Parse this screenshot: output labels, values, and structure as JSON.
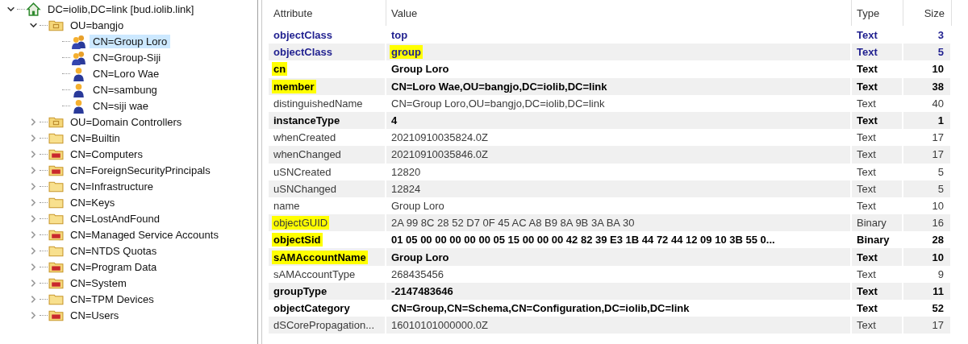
{
  "tree": {
    "label": "DC=iolib,DC=link [bud.iolib.link]",
    "kind": "domain",
    "expanded": true,
    "selected": false,
    "children": [
      {
        "label": "OU=bangjo",
        "kind": "ou",
        "expanded": true,
        "selected": false,
        "children": [
          {
            "label": "CN=Group Loro",
            "kind": "group",
            "selected": true
          },
          {
            "label": "CN=Group-Siji",
            "kind": "group",
            "selected": false
          },
          {
            "label": "CN=Loro Wae",
            "kind": "user",
            "selected": false
          },
          {
            "label": "CN=sambung",
            "kind": "user",
            "selected": false
          },
          {
            "label": "CN=siji wae",
            "kind": "user",
            "selected": false
          }
        ]
      },
      {
        "label": "OU=Domain Controllers",
        "kind": "ou",
        "expanded": false,
        "selected": false
      },
      {
        "label": "CN=Builtin",
        "kind": "folder",
        "expanded": false,
        "selected": false
      },
      {
        "label": "CN=Computers",
        "kind": "container",
        "expanded": false,
        "selected": false
      },
      {
        "label": "CN=ForeignSecurityPrincipals",
        "kind": "container",
        "expanded": false,
        "selected": false
      },
      {
        "label": "CN=Infrastructure",
        "kind": "folder",
        "expanded": false,
        "selected": false
      },
      {
        "label": "CN=Keys",
        "kind": "folder",
        "expanded": false,
        "selected": false
      },
      {
        "label": "CN=LostAndFound",
        "kind": "folder",
        "expanded": false,
        "selected": false
      },
      {
        "label": "CN=Managed Service Accounts",
        "kind": "container",
        "expanded": false,
        "selected": false
      },
      {
        "label": "CN=NTDS Quotas",
        "kind": "folder",
        "expanded": false,
        "selected": false
      },
      {
        "label": "CN=Program Data",
        "kind": "container",
        "expanded": false,
        "selected": false
      },
      {
        "label": "CN=System",
        "kind": "container",
        "expanded": false,
        "selected": false
      },
      {
        "label": "CN=TPM Devices",
        "kind": "folder",
        "expanded": false,
        "selected": false
      },
      {
        "label": "CN=Users",
        "kind": "container",
        "expanded": false,
        "selected": false
      }
    ]
  },
  "table": {
    "columns": [
      "Attribute",
      "Value",
      "Type",
      "Size"
    ],
    "rows": [
      {
        "kind": "class",
        "attribute": "objectClass",
        "value": "top",
        "type": "Text",
        "size": "3",
        "attribute_highlighted": false,
        "value_highlighted": false
      },
      {
        "kind": "class",
        "attribute": "objectClass",
        "value": "group",
        "type": "Text",
        "size": "5",
        "attribute_highlighted": false,
        "value_highlighted": true
      },
      {
        "kind": "bold",
        "attribute": "cn",
        "value": "Group Loro",
        "type": "Text",
        "size": "10",
        "attribute_highlighted": true,
        "value_highlighted": false
      },
      {
        "kind": "bold",
        "attribute": "member",
        "value": "CN=Loro Wae,OU=bangjo,DC=iolib,DC=link",
        "type": "Text",
        "size": "38",
        "attribute_highlighted": true,
        "value_highlighted": false
      },
      {
        "kind": "plain",
        "attribute": "distinguishedName",
        "value": "CN=Group Loro,OU=bangjo,DC=iolib,DC=link",
        "type": "Text",
        "size": "40",
        "attribute_highlighted": false,
        "value_highlighted": false
      },
      {
        "kind": "bold",
        "attribute": "instanceType",
        "value": "4",
        "type": "Text",
        "size": "1",
        "attribute_highlighted": false,
        "value_highlighted": false
      },
      {
        "kind": "plain",
        "attribute": "whenCreated",
        "value": "20210910035824.0Z",
        "type": "Text",
        "size": "17",
        "attribute_highlighted": false,
        "value_highlighted": false
      },
      {
        "kind": "plain",
        "attribute": "whenChanged",
        "value": "20210910035846.0Z",
        "type": "Text",
        "size": "17",
        "attribute_highlighted": false,
        "value_highlighted": false
      },
      {
        "kind": "plain",
        "attribute": "uSNCreated",
        "value": "12820",
        "type": "Text",
        "size": "5",
        "attribute_highlighted": false,
        "value_highlighted": false
      },
      {
        "kind": "plain",
        "attribute": "uSNChanged",
        "value": "12824",
        "type": "Text",
        "size": "5",
        "attribute_highlighted": false,
        "value_highlighted": false
      },
      {
        "kind": "plain",
        "attribute": "name",
        "value": "Group Loro",
        "type": "Text",
        "size": "10",
        "attribute_highlighted": false,
        "value_highlighted": false
      },
      {
        "kind": "plain",
        "attribute": "objectGUID",
        "value": "2A 99 8C 28 52 D7 0F 45 AC A8 B9 8A 9B 3A BA 30",
        "type": "Binary",
        "size": "16",
        "attribute_highlighted": true,
        "value_highlighted": false
      },
      {
        "kind": "bold",
        "attribute": "objectSid",
        "value": "01 05 00 00 00 00 00 05 15 00 00 00 42 82 39 E3 1B 44 72 44 12 09 10 3B 55 0...",
        "type": "Binary",
        "size": "28",
        "attribute_highlighted": true,
        "value_highlighted": false
      },
      {
        "kind": "bold",
        "attribute": "sAMAccountName",
        "value": "Group Loro",
        "type": "Text",
        "size": "10",
        "attribute_highlighted": true,
        "value_highlighted": false
      },
      {
        "kind": "plain",
        "attribute": "sAMAccountType",
        "value": "268435456",
        "type": "Text",
        "size": "9",
        "attribute_highlighted": false,
        "value_highlighted": false
      },
      {
        "kind": "bold",
        "attribute": "groupType",
        "value": "-2147483646",
        "type": "Text",
        "size": "11",
        "attribute_highlighted": false,
        "value_highlighted": false
      },
      {
        "kind": "bold",
        "attribute": "objectCategory",
        "value": "CN=Group,CN=Schema,CN=Configuration,DC=iolib,DC=link",
        "type": "Text",
        "size": "52",
        "attribute_highlighted": false,
        "value_highlighted": false
      },
      {
        "kind": "plain",
        "attribute": "dSCorePropagation...",
        "value": "16010101000000.0Z",
        "type": "Text",
        "size": "17",
        "attribute_highlighted": false,
        "value_highlighted": false
      }
    ]
  }
}
